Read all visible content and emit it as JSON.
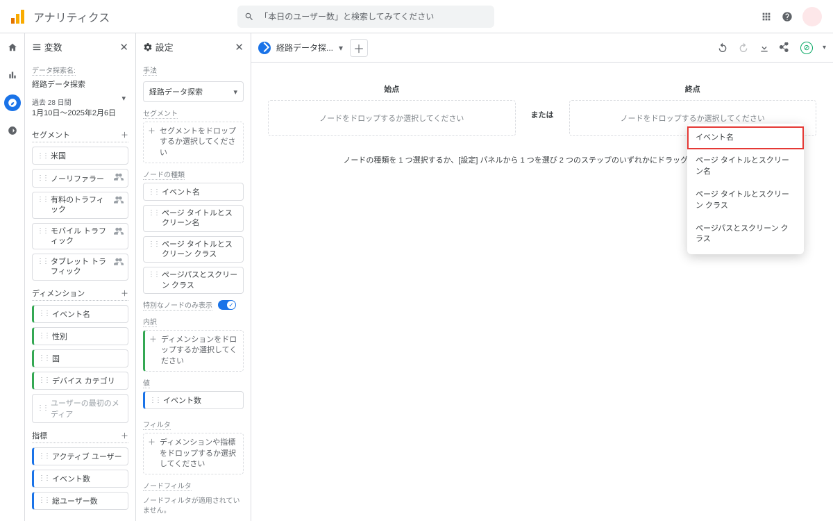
{
  "app": {
    "title": "アナリティクス"
  },
  "search": {
    "placeholder": "「本日のユーザー数」と検索してみてください"
  },
  "panels": {
    "variables": {
      "title": "変数"
    },
    "settings": {
      "title": "設定"
    }
  },
  "exploration": {
    "name_label": "データ探索名:",
    "name_value": "経路データ探索",
    "date_range_label": "過去 28 日間",
    "date_range_value": "1月10日～2025年2月6日"
  },
  "segments": {
    "header": "セグメント",
    "items": [
      "米国",
      "ノーリファラー",
      "有料のトラフィック",
      "モバイル トラフィック",
      "タブレット トラフィック"
    ]
  },
  "dimensions": {
    "header": "ディメンション",
    "items": [
      "イベント名",
      "性別",
      "国",
      "デバイス カテゴリ",
      "ユーザーの最初のメディア"
    ]
  },
  "metrics": {
    "header": "指標",
    "items": [
      "アクティブ ユーザー",
      "イベント数",
      "総ユーザー数"
    ]
  },
  "settings": {
    "technique_label": "手法",
    "technique_value": "経路データ探索",
    "segments_label": "セグメント",
    "segments_placeholder": "セグメントをドロップするか選択してください",
    "node_type_label": "ノードの種類",
    "node_types": [
      "イベント名",
      "ページ タイトルとスクリーン名",
      "ページ タイトルとスクリーン クラス",
      "ページパスとスクリーン クラス"
    ],
    "unique_nodes_label": "特別なノードのみ表示",
    "breakdown_label": "内訳",
    "breakdown_placeholder": "ディメンションをドロップするか選択してください",
    "values_label": "値",
    "values_item": "イベント数",
    "filters_label": "フィルタ",
    "filters_placeholder": "ディメンションや指標をドロップするか選択してください",
    "node_filter_label": "ノードフィルタ",
    "node_filter_note": "ノードフィルタが適用されていません。"
  },
  "canvas": {
    "tab_label": "経路データ探...",
    "start_label": "始点",
    "end_label": "終点",
    "node_placeholder": "ノードをドロップするか選択してください",
    "or_label": "または",
    "hint": "ノードの種類を 1 つ選択するか、[設定] パネルから 1 つを選び 2 つのステップのいずれかにドラッグ＆ドロップして"
  },
  "dropdown": {
    "items": [
      "イベント名",
      "ページ タイトルとスクリーン名",
      "ページ タイトルとスクリーン クラス",
      "ページパスとスクリーン クラス"
    ],
    "highlighted_index": 0
  }
}
